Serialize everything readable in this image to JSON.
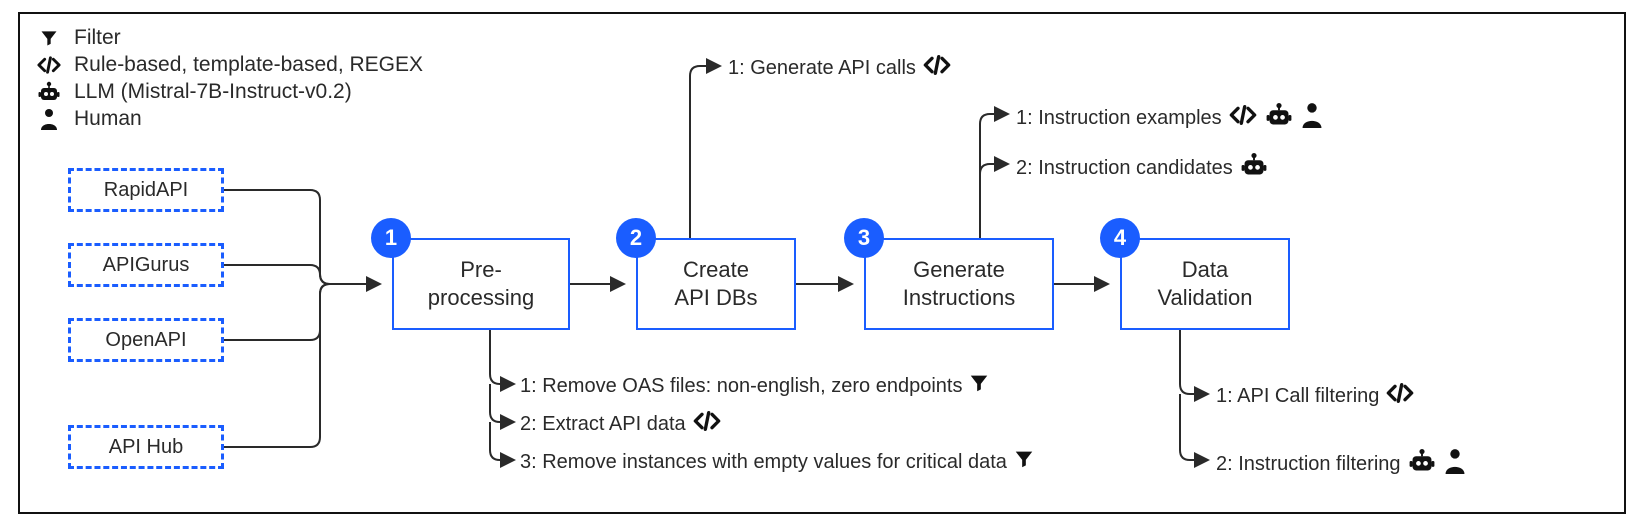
{
  "legend": {
    "filter": "Filter",
    "rule": "Rule-based, template-based, REGEX",
    "llm": "LLM (Mistral-7B-Instruct-v0.2)",
    "human": "Human"
  },
  "sources": {
    "s1": "RapidAPI",
    "s2": "APIGurus",
    "s3": "OpenAPI",
    "s4": "API Hub"
  },
  "steps": {
    "n1": "1",
    "t1a": "Pre-",
    "t1b": "processing",
    "n2": "2",
    "t2a": "Create",
    "t2b": "API DBs",
    "n3": "3",
    "t3a": "Generate",
    "t3b": "Instructions",
    "n4": "4",
    "t4a": "Data",
    "t4b": "Validation"
  },
  "notes": {
    "pre1": "1: Remove OAS files: non-english, zero endpoints",
    "pre2": "2: Extract API data",
    "pre3": "3: Remove instances with empty values for critical data",
    "db1": "1: Generate API calls",
    "gi1": "1: Instruction examples",
    "gi2": "2: Instruction candidates",
    "dv1": "1: API Call filtering",
    "dv2": "2: Instruction filtering"
  }
}
